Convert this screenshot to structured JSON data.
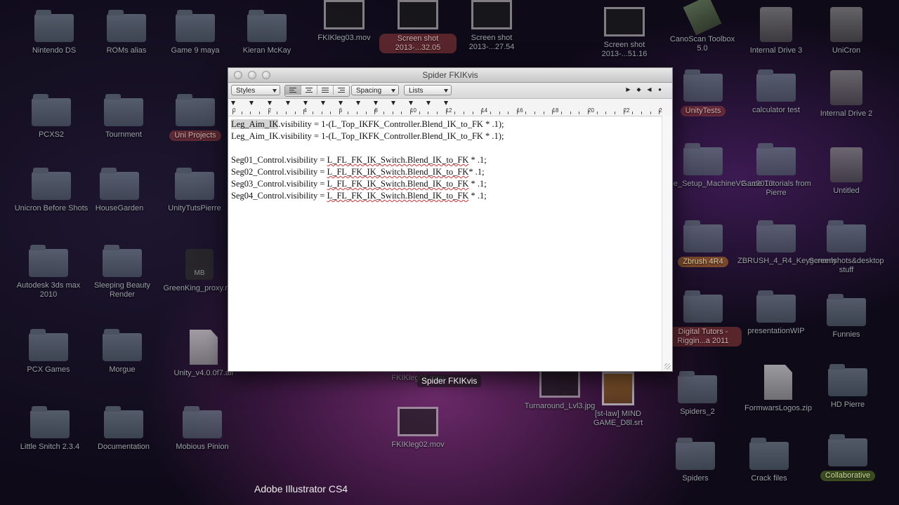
{
  "desktop_icons": [
    {
      "label": "Nintendo DS",
      "type": "folder"
    },
    {
      "label": "ROMs alias",
      "type": "folder"
    },
    {
      "label": "Game 9 maya",
      "type": "folder"
    },
    {
      "label": "Kieran McKay",
      "type": "folder"
    },
    {
      "label": "FKIKleg03.mov",
      "type": "thumb"
    },
    {
      "label": "Screen shot 2013-...32.05",
      "type": "thumb"
    },
    {
      "label": "Screen shot 2013-...27.54",
      "type": "thumb"
    },
    {
      "label": "Screen shot 2013-...51.16",
      "type": "thumb"
    },
    {
      "label": "CanoScan Toolbox 5.0",
      "type": "tool"
    },
    {
      "label": "Internal Drive 3",
      "type": "drive"
    },
    {
      "label": "UniCron",
      "type": "drive"
    },
    {
      "label": "PCXS2",
      "type": "folder"
    },
    {
      "label": "Tournment",
      "type": "folder"
    },
    {
      "label": "Uni Projects",
      "type": "folder"
    },
    {
      "label": "UnityTests",
      "type": "folder"
    },
    {
      "label": "calculator test",
      "type": "folder"
    },
    {
      "label": "Internal Drive 2",
      "type": "drive"
    },
    {
      "label": "Unicron Before Shots",
      "type": "folder"
    },
    {
      "label": "HouseGarden",
      "type": "folder"
    },
    {
      "label": "UnityTutsPierre",
      "type": "folder"
    },
    {
      "label": "The_Setup_MachineV2...a2013",
      "type": "folder"
    },
    {
      "label": "Game Tutorials from Pierre",
      "type": "folder"
    },
    {
      "label": "Untitled",
      "type": "drive"
    },
    {
      "label": "Autodesk 3ds max 2010",
      "type": "folder"
    },
    {
      "label": "Sleeping Beauty Render",
      "type": "folder"
    },
    {
      "label": "GreenKing_proxy.mb",
      "type": "mb"
    },
    {
      "label": "Zbrush 4R4",
      "type": "folder"
    },
    {
      "label": "ZBRUSH_4_R4_Keygenonly",
      "type": "folder"
    },
    {
      "label": "Screenshots&desktop stuff",
      "type": "folder"
    },
    {
      "label": "PCX Games",
      "type": "folder"
    },
    {
      "label": "Morgue",
      "type": "folder"
    },
    {
      "label": "Unity_v4.0.0f7.alf",
      "type": "doc"
    },
    {
      "label": "Digital Tutors - Riggin...a 2011",
      "type": "folder"
    },
    {
      "label": "presentationWIP",
      "type": "folder"
    },
    {
      "label": "Funnies",
      "type": "folder"
    },
    {
      "label": "FKIKleg01.mov",
      "type": "thumb"
    },
    {
      "label": "Turnaround_Lvl3.jpg",
      "type": "thumb"
    },
    {
      "label": "[st-law] MIND GAME_D8l.srt",
      "type": "img"
    },
    {
      "label": "Spiders_2",
      "type": "folder"
    },
    {
      "label": "FormwarsLogos.zip",
      "type": "doc"
    },
    {
      "label": "HD Pierre",
      "type": "folder"
    },
    {
      "label": "Little Snitch 2.3.4",
      "type": "folder"
    },
    {
      "label": "Documentation",
      "type": "folder"
    },
    {
      "label": "Mobious Pinion",
      "type": "folder"
    },
    {
      "label": "FKIKleg02.mov",
      "type": "thumb"
    },
    {
      "label": "Spiders",
      "type": "folder"
    },
    {
      "label": "Crack files",
      "type": "folder"
    },
    {
      "label": "Collaborative",
      "type": "folder"
    }
  ],
  "window": {
    "title": "Spider FKIKvis",
    "toolbar": {
      "styles": "Styles",
      "spacing": "Spacing",
      "lists": "Lists"
    },
    "ruler_numbers": [
      "0",
      "2",
      "4",
      "6",
      "8",
      "10",
      "12",
      "14",
      "16",
      "18",
      "20",
      "22",
      "2"
    ],
    "lines": [
      {
        "a": "Leg_Aim_IK",
        "b": ".visibility = 1-(L_Top_IKFK_Controller.Blend_IK_to_FK * .1);"
      },
      {
        "a": "",
        "b": "Leg_Aim_IK.visibility = 1-(L_Top_IKFK_Controller.Blend_IK_to_FK * .1);"
      },
      {
        "a": "",
        "b": ""
      },
      {
        "a": "Seg01_Control.visibility = ",
        "b": "L_FL_FK_IK_Switch.Blend_IK_to_FK",
        "c": " * .1;"
      },
      {
        "a": "Seg02_Control.visibility = ",
        "b": "L_FL_FK_IK_Switch.Blend_IK_to_FK",
        "c": "* .1;"
      },
      {
        "a": "Seg03_Control.visibility = ",
        "b": "L_FL_FK_IK_Switch.Blend_IK_to_FK",
        "c": " * .1;"
      },
      {
        "a": "Seg04_Control.visibility = ",
        "b": "L_FL_FK_IK_Switch.Blend_IK_to_FK",
        "c": " * .1;"
      }
    ]
  },
  "tooltip": "Spider FKIKvis",
  "app_name": "Adobe Illustrator CS4"
}
